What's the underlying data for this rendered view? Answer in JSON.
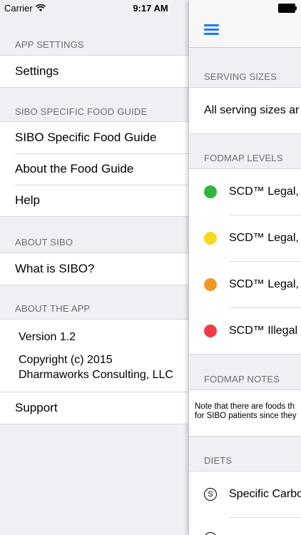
{
  "status": {
    "carrier": "Carrier",
    "time": "9:17 AM"
  },
  "menu": {
    "sections": {
      "app_settings": "APP SETTINGS",
      "food_guide": "SIBO SPECIFIC FOOD GUIDE",
      "about_sibo": "ABOUT SIBO",
      "about_app": "ABOUT THE APP"
    },
    "items": {
      "settings": "Settings",
      "food_guide": "SIBO Specific Food Guide",
      "about_guide": "About the Food Guide",
      "help": "Help",
      "what_is_sibo": "What is SIBO?",
      "support": "Support"
    },
    "about": {
      "version": "Version 1.2",
      "copyright": "Copyright (c) 2015",
      "company": "Dharmaworks Consulting, LLC"
    }
  },
  "panel": {
    "headers": {
      "serving": "SERVING SIZES",
      "fodmap_levels": "FODMAP LEVELS",
      "fodmap_notes": "FODMAP NOTES",
      "diets": "DIETS"
    },
    "serving_text": "All serving sizes ar",
    "levels": [
      {
        "label": "SCD™ Legal,",
        "color": "#2db83d"
      },
      {
        "label": "SCD™ Legal,",
        "color": "#f5d81f"
      },
      {
        "label": "SCD™ Legal,",
        "color": "#f5962a"
      },
      {
        "label": "SCD™ Illegal",
        "color": "#ef3d45"
      }
    ],
    "notes_line1": "Note that there are foods th",
    "notes_line2": "for SIBO patients since they",
    "diet_icon": "S",
    "diet_label": "Specific Carbo"
  }
}
